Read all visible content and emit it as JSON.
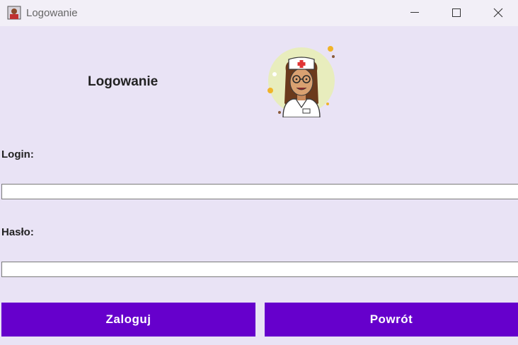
{
  "window": {
    "title": "Logowanie"
  },
  "form": {
    "heading": "Logowanie",
    "login_label": "Login:",
    "login_value": "",
    "password_label": "Hasło:",
    "password_value": ""
  },
  "buttons": {
    "login": "Zaloguj",
    "back": "Powrót"
  },
  "colors": {
    "background": "#e9e3f5",
    "button": "#6600cc",
    "button_text": "#ffffff"
  },
  "icons": {
    "app": "nurse-app-icon",
    "avatar": "nurse-avatar-icon"
  }
}
